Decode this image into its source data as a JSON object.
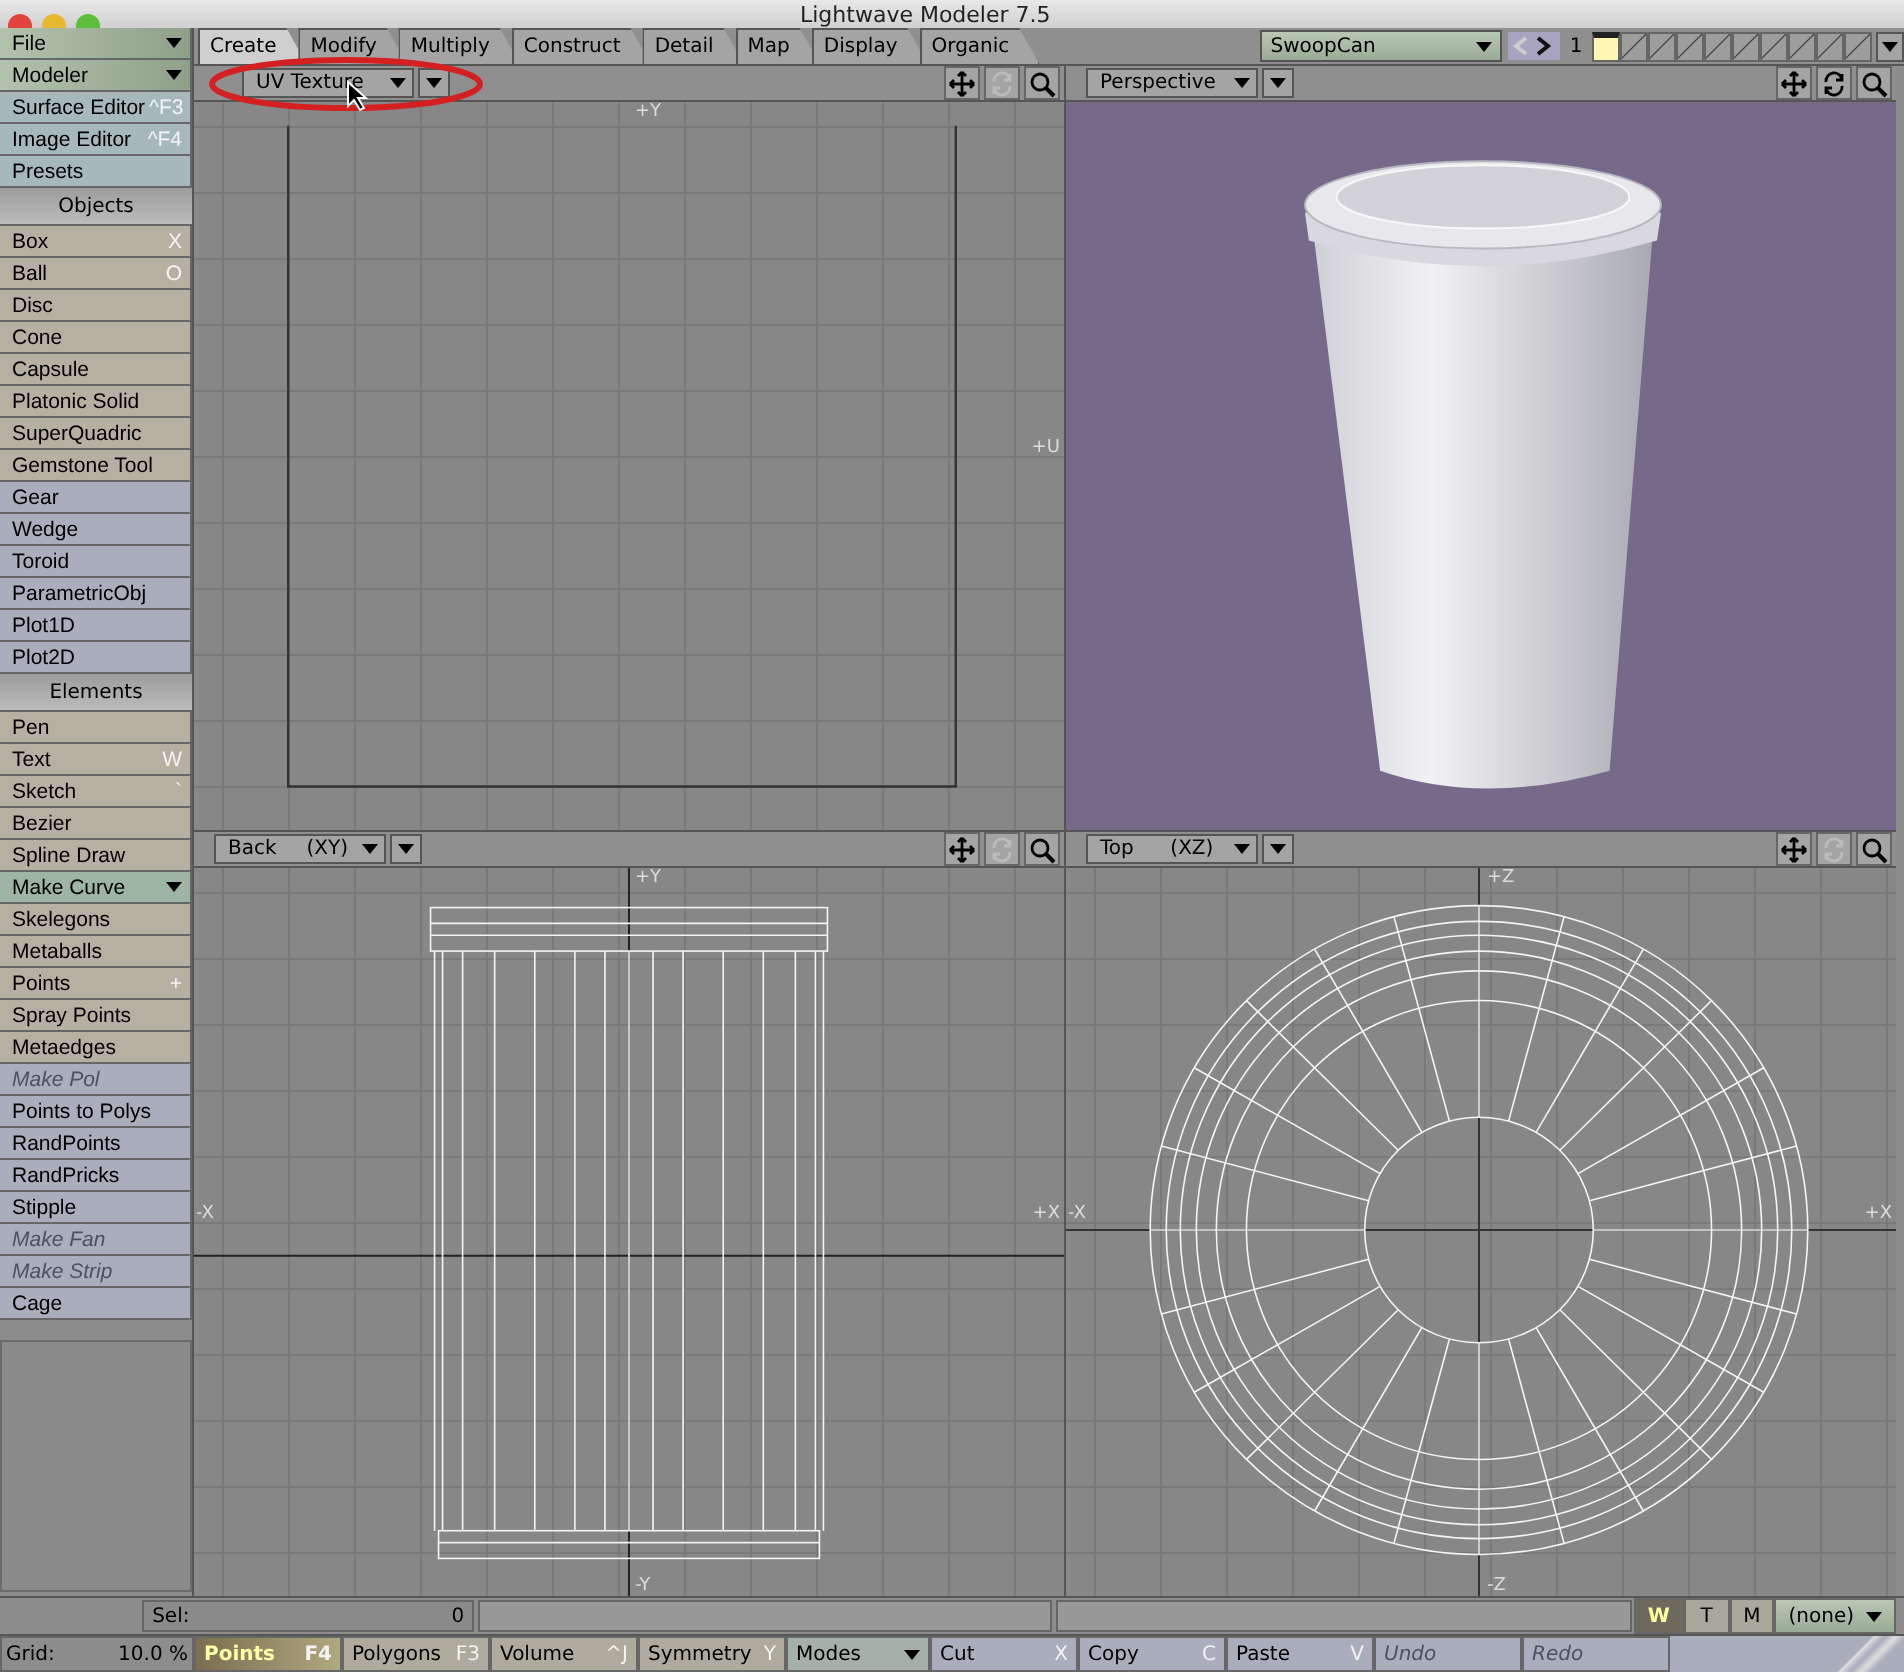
{
  "window": {
    "title": "Lightwave Modeler 7.5"
  },
  "sidebar": {
    "menus": [
      {
        "label": "File"
      },
      {
        "label": "Modeler"
      }
    ],
    "items": [
      {
        "kind": "tool",
        "label": "Surface Editor",
        "shortcut": "^F3",
        "color": "#a7b8ba",
        "disabled": false
      },
      {
        "kind": "tool",
        "label": "Image Editor",
        "shortcut": "^F4",
        "color": "#a7b8ba",
        "disabled": false
      },
      {
        "kind": "tool",
        "label": "Presets",
        "color": "#a7b8ba",
        "disabled": false
      },
      {
        "kind": "header",
        "label": "Objects"
      },
      {
        "kind": "tool",
        "label": "Box",
        "shortcut": "X",
        "color": "#b8afa3",
        "disabled": false
      },
      {
        "kind": "tool",
        "label": "Ball",
        "shortcut": "O",
        "color": "#b8afa3",
        "disabled": false
      },
      {
        "kind": "tool",
        "label": "Disc",
        "color": "#b8afa3",
        "disabled": false
      },
      {
        "kind": "tool",
        "label": "Cone",
        "color": "#b8afa3",
        "disabled": false
      },
      {
        "kind": "tool",
        "label": "Capsule",
        "color": "#b8afa3",
        "disabled": false
      },
      {
        "kind": "tool",
        "label": "Platonic Solid",
        "color": "#b8afa3",
        "disabled": false
      },
      {
        "kind": "tool",
        "label": "SuperQuadric",
        "color": "#b8afa3",
        "disabled": false
      },
      {
        "kind": "tool",
        "label": "Gemstone Tool",
        "color": "#b8afa3",
        "disabled": false
      },
      {
        "kind": "tool",
        "label": "Gear",
        "color": "#a9adbc",
        "disabled": false
      },
      {
        "kind": "tool",
        "label": "Wedge",
        "color": "#a9adbc",
        "disabled": false
      },
      {
        "kind": "tool",
        "label": "Toroid",
        "color": "#a9adbc",
        "disabled": false
      },
      {
        "kind": "tool",
        "label": "ParametricObj",
        "color": "#a9adbc",
        "disabled": false
      },
      {
        "kind": "tool",
        "label": "Plot1D",
        "color": "#a9adbc",
        "disabled": false
      },
      {
        "kind": "tool",
        "label": "Plot2D",
        "color": "#a9adbc",
        "disabled": false
      },
      {
        "kind": "header",
        "label": "Elements"
      },
      {
        "kind": "tool",
        "label": "Pen",
        "color": "#b8afa3",
        "disabled": false
      },
      {
        "kind": "tool",
        "label": "Text",
        "shortcut": "W",
        "color": "#b8afa3",
        "disabled": false
      },
      {
        "kind": "tool",
        "label": "Sketch",
        "shortcut": "`",
        "color": "#b8afa3",
        "disabled": false
      },
      {
        "kind": "tool",
        "label": "Bezier",
        "color": "#b8afa3",
        "disabled": false
      },
      {
        "kind": "tool",
        "label": "Spline Draw",
        "color": "#b8afa3",
        "disabled": false
      },
      {
        "kind": "menu",
        "label": "Make Curve",
        "color": "#9fb5a4"
      },
      {
        "kind": "tool",
        "label": "Skelegons",
        "color": "#b8afa3",
        "disabled": false
      },
      {
        "kind": "tool",
        "label": "Metaballs",
        "color": "#b8afa3",
        "disabled": false
      },
      {
        "kind": "tool",
        "label": "Points",
        "shortcut": "+",
        "color": "#b8afa3",
        "disabled": false
      },
      {
        "kind": "tool",
        "label": "Spray Points",
        "color": "#b8afa3",
        "disabled": false
      },
      {
        "kind": "tool",
        "label": "Metaedges",
        "color": "#b8afa3",
        "disabled": false
      },
      {
        "kind": "tool",
        "label": "Make Pol",
        "color": "#a9adbc",
        "disabled": true
      },
      {
        "kind": "tool",
        "label": "Points to Polys",
        "color": "#a9adbc",
        "disabled": false
      },
      {
        "kind": "tool",
        "label": "RandPoints",
        "color": "#a9adbc",
        "disabled": false
      },
      {
        "kind": "tool",
        "label": "RandPricks",
        "color": "#a9adbc",
        "disabled": false
      },
      {
        "kind": "tool",
        "label": "Stipple",
        "color": "#a9adbc",
        "disabled": false
      },
      {
        "kind": "tool",
        "label": "Make Fan",
        "color": "#a9adbc",
        "disabled": true
      },
      {
        "kind": "tool",
        "label": "Make Strip",
        "color": "#a9adbc",
        "disabled": true
      },
      {
        "kind": "tool",
        "label": "Cage",
        "color": "#a9adbc",
        "disabled": false
      }
    ]
  },
  "tabs": [
    {
      "label": "Create",
      "selected": true
    },
    {
      "label": "Modify",
      "selected": false
    },
    {
      "label": "Multiply",
      "selected": false
    },
    {
      "label": "Construct",
      "selected": false
    },
    {
      "label": "Detail",
      "selected": false
    },
    {
      "label": "Map",
      "selected": false
    },
    {
      "label": "Display",
      "selected": false
    },
    {
      "label": "Organic",
      "selected": false
    }
  ],
  "toolbar": {
    "object": "SwoopCan",
    "layer_number": "1",
    "layers": [
      {
        "selected": true
      },
      {
        "selected": false
      },
      {
        "selected": false
      },
      {
        "selected": false
      },
      {
        "selected": false
      },
      {
        "selected": false
      },
      {
        "selected": false
      },
      {
        "selected": false
      },
      {
        "selected": false
      },
      {
        "selected": false
      }
    ]
  },
  "viewports": [
    {
      "kind": "uv",
      "view": "UV Texture",
      "rotate_enabled": false,
      "axis_labels": {
        "top": "+Y",
        "right": "+U"
      }
    },
    {
      "kind": "perspective",
      "view": "Perspective",
      "rotate_enabled": true
    },
    {
      "kind": "back",
      "view": "Back",
      "plane": "(XY)",
      "rotate_enabled": false,
      "axis_labels": {
        "top": "+Y",
        "left": "-X",
        "right": "+X",
        "bottom": "-Y"
      }
    },
    {
      "kind": "top",
      "view": "Top",
      "plane": "(XZ)",
      "rotate_enabled": false,
      "axis_labels": {
        "top": "+Z",
        "left": "-X",
        "right": "+X",
        "bottom": "-Z"
      }
    }
  ],
  "status_bar": {
    "sel_label": "Sel:",
    "sel_value": "0",
    "view_modes": [
      {
        "label": "W",
        "selected": true
      },
      {
        "label": "T",
        "selected": false
      },
      {
        "label": "M",
        "selected": false
      }
    ],
    "surface": "(none)",
    "grid_label": "Grid:",
    "grid_value": "10.0 %",
    "select_modes": [
      {
        "label": "Points",
        "shortcut": "F4",
        "selected": true
      },
      {
        "label": "Polygons",
        "shortcut": "F3",
        "selected": false
      },
      {
        "label": "Volume",
        "shortcut": "^J",
        "selected": false
      }
    ],
    "symmetry": {
      "label": "Symmetry",
      "shortcut": "Y"
    },
    "modes": "Modes",
    "edit_buttons": [
      {
        "label": "Cut",
        "shortcut": "X",
        "disabled": false
      },
      {
        "label": "Copy",
        "shortcut": "C",
        "disabled": false
      },
      {
        "label": "Paste",
        "shortcut": "V",
        "disabled": false
      },
      {
        "label": "Undo",
        "disabled": true
      },
      {
        "label": "Redo",
        "disabled": true
      }
    ]
  }
}
